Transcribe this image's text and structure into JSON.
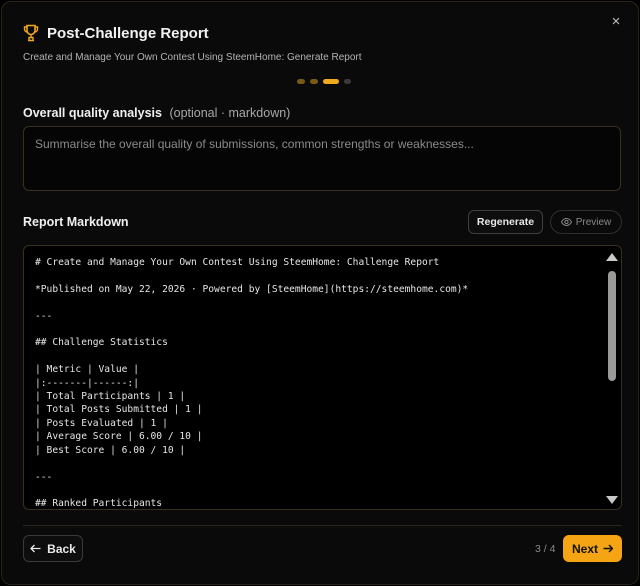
{
  "dialog": {
    "title": "Post-Challenge Report",
    "subtitle": "Create and Manage Your Own Contest Using SteemHome: Generate Report",
    "close_icon": "×",
    "steps": {
      "current": 3,
      "total": 4
    }
  },
  "quality": {
    "label": "Overall quality analysis",
    "optional_note": "(optional · markdown)",
    "placeholder": "Summarise the overall quality of submissions, common strengths or weaknesses..."
  },
  "report": {
    "label": "Report Markdown",
    "regenerate_label": "Regenerate",
    "preview_label": "Preview",
    "markdown": "# Create and Manage Your Own Contest Using SteemHome: Challenge Report\n\n*Published on May 22, 2026 · Powered by [SteemHome](https://steemhome.com)*\n\n---\n\n## Challenge Statistics\n\n| Metric | Value |\n|:-------|------:|\n| Total Participants | 1 |\n| Total Posts Submitted | 1 |\n| Posts Evaluated | 1 |\n| Average Score | 6.00 / 10 |\n| Best Score | 6.00 / 10 |\n\n---\n\n## Ranked Participants"
  },
  "footer": {
    "back_label": "Back",
    "step_text": "3 / 4",
    "next_label": "Next"
  },
  "colors": {
    "accent": "#f5a414",
    "background": "#0a0a0a",
    "border": "#3a2f1e"
  }
}
